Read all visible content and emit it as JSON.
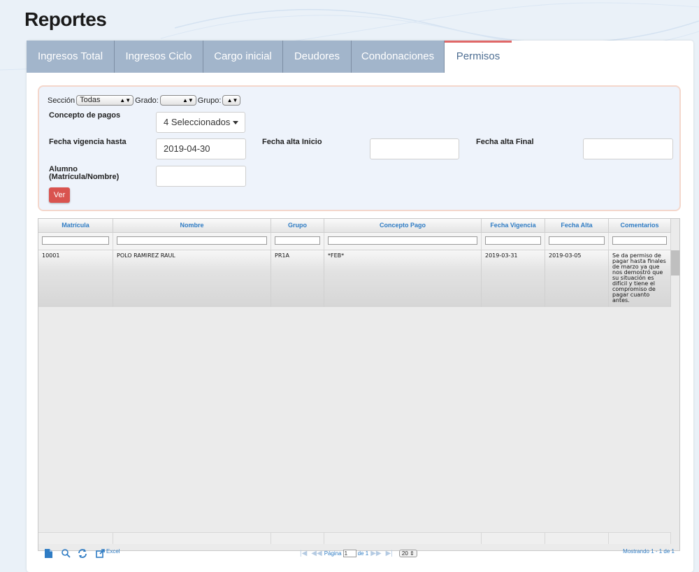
{
  "page_title": "Reportes",
  "tabs": [
    {
      "label": "Ingresos Total"
    },
    {
      "label": "Ingresos Ciclo"
    },
    {
      "label": "Cargo inicial"
    },
    {
      "label": "Deudores"
    },
    {
      "label": "Condonaciones"
    },
    {
      "label": "Permisos",
      "active": true
    }
  ],
  "filters": {
    "seccion_label": "Sección",
    "seccion_value": "Todas",
    "grado_label": "Grado:",
    "grado_value": "",
    "grupo_label": "Grupo:",
    "grupo_value": "",
    "concepto_label": "Concepto de pagos",
    "concepto_value": "4 Seleccionados",
    "fecha_vigencia_label": "Fecha vigencia hasta",
    "fecha_vigencia_value": "2019-04-30",
    "fecha_alta_inicio_label": "Fecha alta Inicio",
    "fecha_alta_inicio_value": "",
    "fecha_alta_final_label": "Fecha alta Final",
    "fecha_alta_final_value": "",
    "alumno_label_1": "Alumno",
    "alumno_label_2": "(Matrícula/Nombre)",
    "alumno_value": "",
    "ver_label": "Ver"
  },
  "grid": {
    "columns": [
      "Matrícula",
      "Nombre",
      "Grupo",
      "Concepto Pago",
      "Fecha Vigencia",
      "Fecha Alta",
      "Comentarios"
    ],
    "rows": [
      {
        "matricula": "10001",
        "nombre": "POLO RAMIREZ RAUL",
        "grupo": "PR1A",
        "concepto": "*FEB*",
        "fecha_vigencia": "2019-03-31",
        "fecha_alta": "2019-03-05",
        "comentarios": "Se da permiso de pagar hasta finales de marzo ya que nos demostró que su situación es difícil y tiene el compromiso de pagar cuanto antes."
      }
    ]
  },
  "pager": {
    "excel_label": "Excel",
    "page_label": "Página",
    "page_value": "1",
    "of_label": "de 1",
    "rows_per_page": "20",
    "showing": "Mostrando 1 - 1 de 1"
  },
  "colors": {
    "tab_bg": "#a2b5cb",
    "tab_active_border": "#e06868",
    "header_text": "#2f7cc4",
    "button": "#d9534f"
  }
}
